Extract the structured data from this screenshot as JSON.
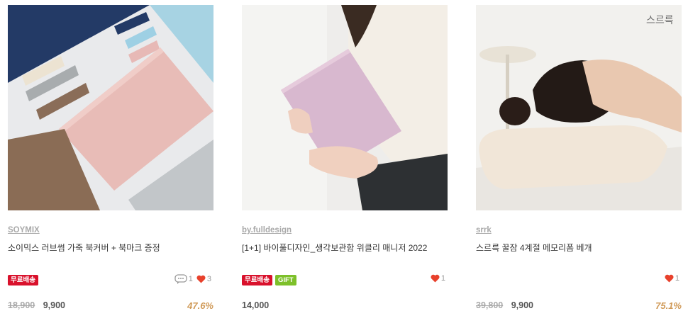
{
  "products": [
    {
      "brand": "SOYMIX",
      "title": "소이믹스 러브썸 가죽 북커버 + 북마크 증정",
      "badges": [
        {
          "label": "무료배송",
          "color": "red"
        }
      ],
      "comments": "1",
      "likes": "3",
      "original_price": "18,900",
      "price": "9,900",
      "discount": "47.6%"
    },
    {
      "brand": "by.fulldesign",
      "title": "[1+1] 바이풀디자인_생각보관함 위클리 매니저 2022",
      "badges": [
        {
          "label": "무료배송",
          "color": "red"
        },
        {
          "label": "GIFT",
          "color": "green"
        }
      ],
      "likes": "1",
      "price": "14,000"
    },
    {
      "brand": "srrk",
      "title": "스르륵 꿀잠 4계절 메모리폼 베개",
      "badges": [],
      "likes": "1",
      "original_price": "39,800",
      "price": "9,900",
      "discount": "75.1%",
      "image_logo": "스르륵"
    }
  ],
  "colors": {
    "badge_red": "#d9112c",
    "badge_green": "#7dc02a",
    "heart": "#e8412c",
    "discount": "#d09a58"
  },
  "icons": [
    "comment-icon",
    "heart-icon"
  ]
}
